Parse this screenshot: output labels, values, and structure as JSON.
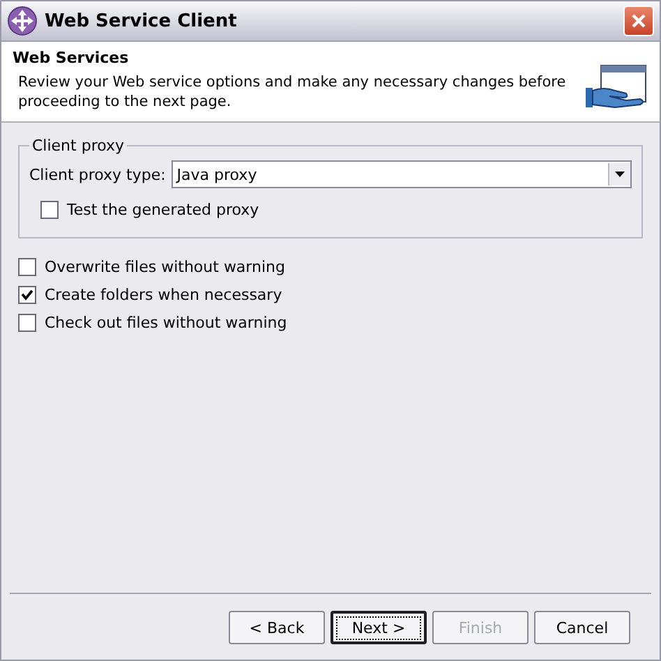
{
  "window": {
    "title": "Web Service Client"
  },
  "header": {
    "title": "Web Services",
    "description": "Review your Web service options and make any necessary changes before proceeding to the next page."
  },
  "client_proxy": {
    "legend": "Client proxy",
    "type_label": "Client proxy type:",
    "type_value": "Java proxy",
    "test": {
      "label": "Test the generated proxy",
      "checked": false
    }
  },
  "options": [
    {
      "label": "Overwrite files without warning",
      "checked": false
    },
    {
      "label": "Create folders when necessary",
      "checked": true
    },
    {
      "label": "Check out files without warning",
      "checked": false
    }
  ],
  "buttons": [
    {
      "label": "< Back",
      "disabled": false,
      "default": false
    },
    {
      "label": "Next >",
      "disabled": false,
      "default": true
    },
    {
      "label": "Finish",
      "disabled": true,
      "default": false
    },
    {
      "label": "Cancel",
      "disabled": false,
      "default": false
    }
  ]
}
